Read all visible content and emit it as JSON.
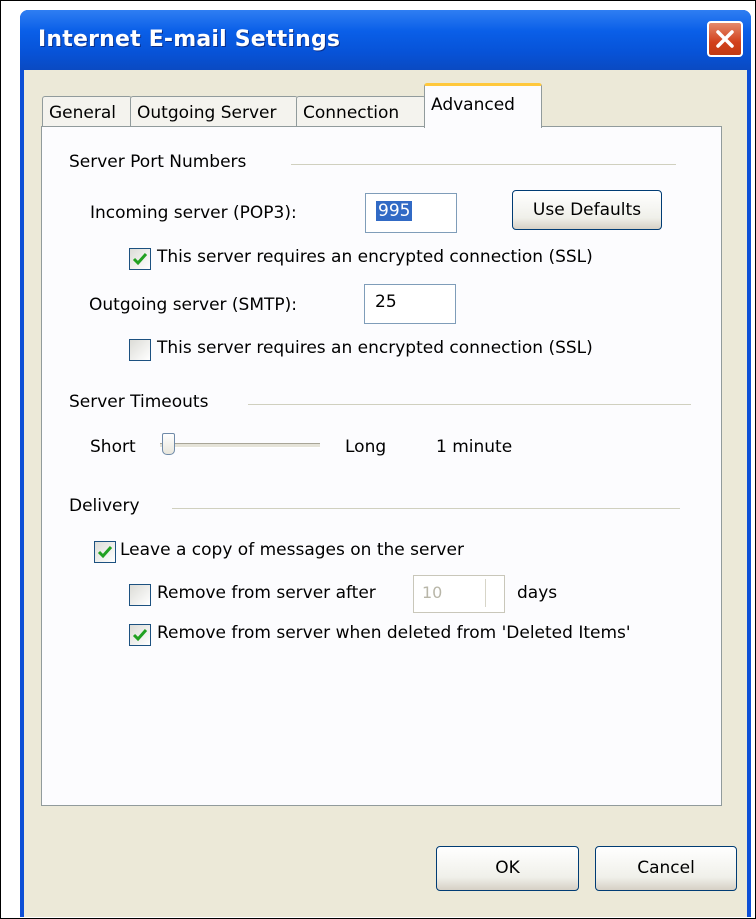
{
  "window": {
    "title": "Internet E-mail Settings"
  },
  "tabs": [
    {
      "label": "General"
    },
    {
      "label": "Outgoing Server"
    },
    {
      "label": "Connection"
    },
    {
      "label": "Advanced"
    }
  ],
  "server_ports": {
    "group_label": "Server Port Numbers",
    "incoming_label": "Incoming server (POP3):",
    "incoming_value": "995",
    "use_defaults_label": "Use Defaults",
    "incoming_ssl_label": "This server requires an encrypted connection (SSL)",
    "incoming_ssl_checked": true,
    "outgoing_label": "Outgoing server (SMTP):",
    "outgoing_value": "25",
    "outgoing_ssl_label": "This server requires an encrypted connection (SSL)",
    "outgoing_ssl_checked": false
  },
  "timeouts": {
    "group_label": "Server Timeouts",
    "short_label": "Short",
    "long_label": "Long",
    "value_text": "1 minute",
    "slider_level": 0.05
  },
  "delivery": {
    "group_label": "Delivery",
    "leave_copy_label": "Leave a copy of messages on the server",
    "leave_copy_checked": true,
    "remove_after_label": "Remove from server after",
    "remove_after_checked": false,
    "remove_after_days": "10",
    "days_label": "days",
    "remove_deleted_label": "Remove from server when deleted from 'Deleted Items'",
    "remove_deleted_checked": true
  },
  "buttons": {
    "ok": "OK",
    "cancel": "Cancel"
  },
  "colors": {
    "titlebar": "#0a5fe8",
    "dialog": "#ece9d8",
    "active_tab_accent": "#ffc83c",
    "close": "#d2411c"
  }
}
